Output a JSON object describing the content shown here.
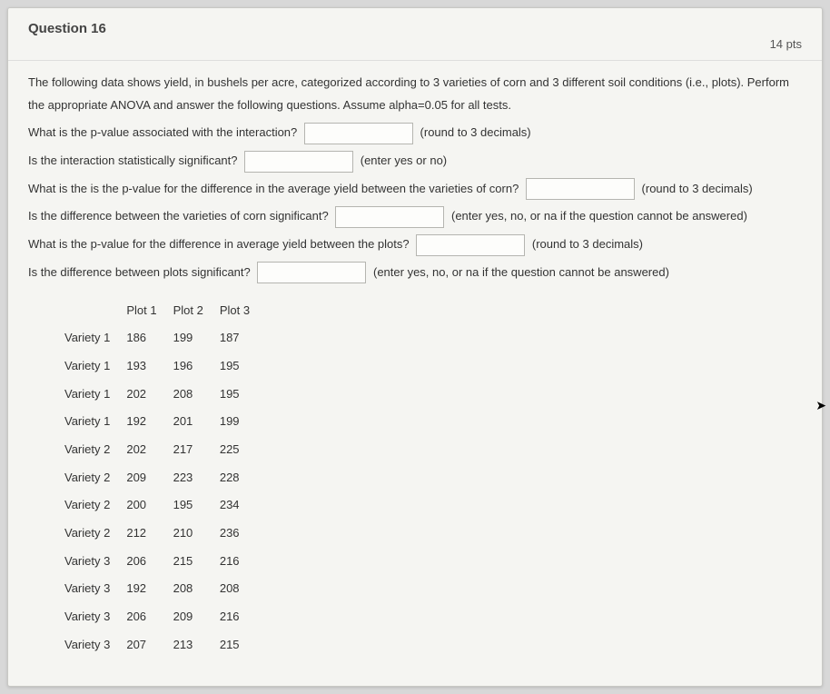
{
  "header": {
    "title": "Question 16",
    "points": "14 pts"
  },
  "intro": "The following data shows yield, in bushels per acre, categorized according to 3 varieties of corn and 3 different soil conditions (i.e., plots). Perform the appropriate ANOVA and answer the following questions. Assume alpha=0.05 for all tests.",
  "q1": {
    "prompt": "What is the p-value associated with the interaction?",
    "hint": "(round to 3 decimals)"
  },
  "q2": {
    "prompt": "Is the interaction statistically significant?",
    "hint": "(enter yes or no)"
  },
  "q3": {
    "prompt": "What is the is the p-value for the difference in the average yield between the varieties of corn?",
    "hint": "(round to 3 decimals)"
  },
  "q4": {
    "prompt": "Is the difference between the varieties of corn significant?",
    "hint": "(enter yes, no, or na if the question cannot be answered)"
  },
  "q5": {
    "prompt": "What is the p-value for the difference in average yield between the plots?",
    "hint": "(round to 3 decimals)"
  },
  "q6": {
    "prompt": "Is the difference between plots significant?",
    "hint": "(enter yes, no, or na if the question cannot be answered)"
  },
  "table": {
    "headers": [
      "",
      "Plot 1",
      "Plot 2",
      "Plot 3"
    ],
    "rows": [
      [
        "Variety 1",
        "186",
        "199",
        "187"
      ],
      [
        "Variety 1",
        "193",
        "196",
        "195"
      ],
      [
        "Variety 1",
        "202",
        "208",
        "195"
      ],
      [
        "Variety 1",
        "192",
        "201",
        "199"
      ],
      [
        "Variety 2",
        "202",
        "217",
        "225"
      ],
      [
        "Variety 2",
        "209",
        "223",
        "228"
      ],
      [
        "Variety 2",
        "200",
        "195",
        "234"
      ],
      [
        "Variety 2",
        "212",
        "210",
        "236"
      ],
      [
        "Variety 3",
        "206",
        "215",
        "216"
      ],
      [
        "Variety 3",
        "192",
        "208",
        "208"
      ],
      [
        "Variety 3",
        "206",
        "209",
        "216"
      ],
      [
        "Variety 3",
        "207",
        "213",
        "215"
      ]
    ]
  }
}
